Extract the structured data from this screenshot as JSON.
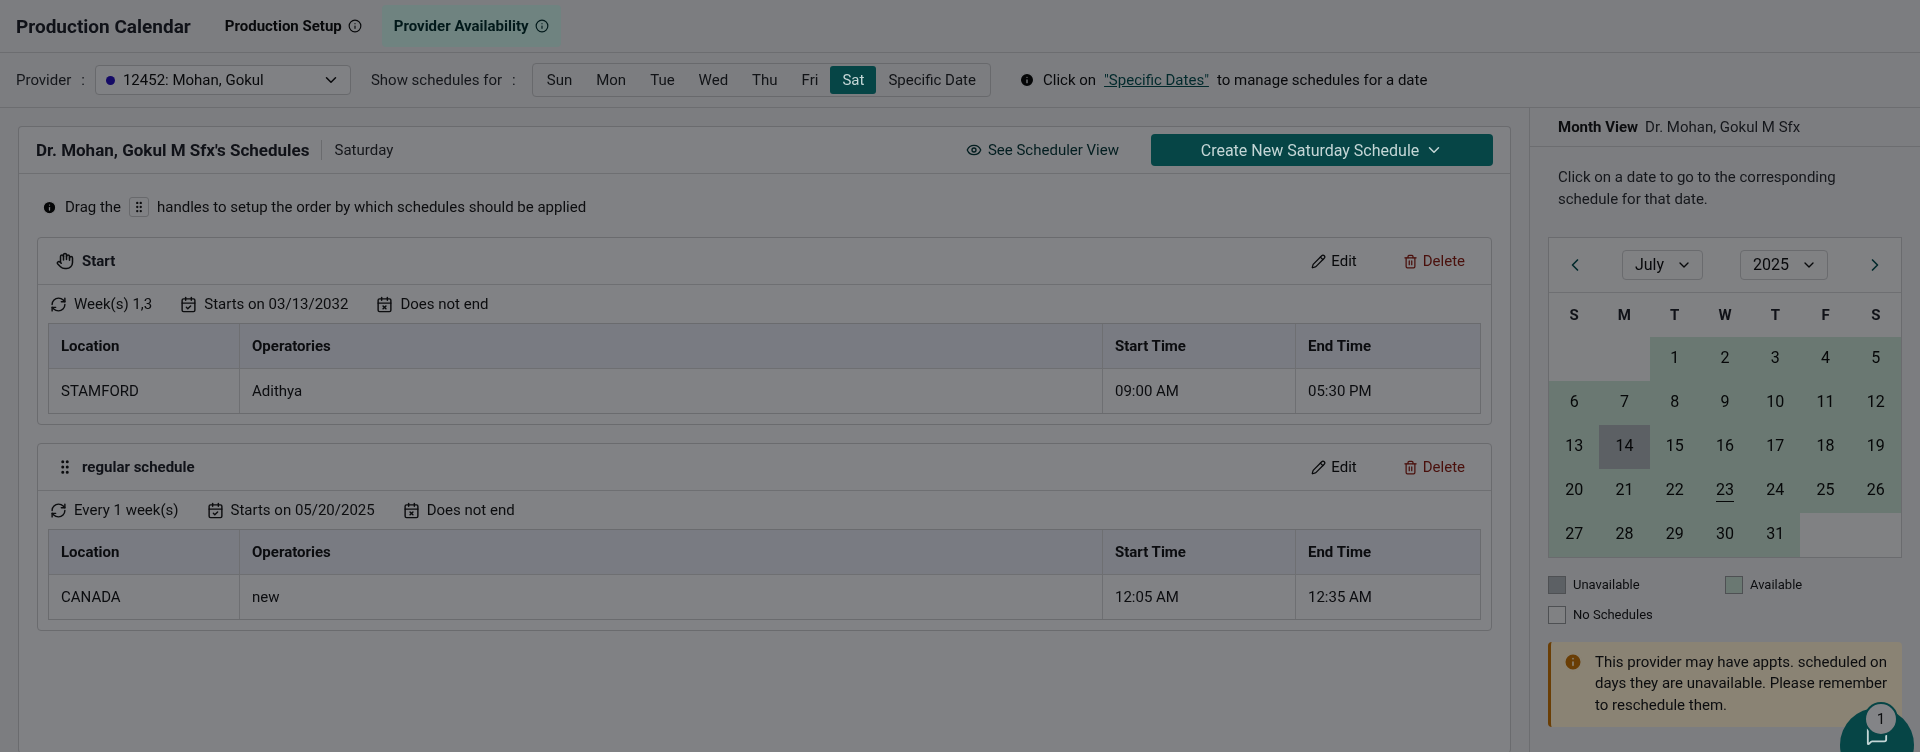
{
  "header": {
    "title": "Production Calendar",
    "tabs": [
      {
        "label": "Production Setup",
        "selected": false
      },
      {
        "label": "Provider Availability",
        "selected": true
      }
    ]
  },
  "toolbar": {
    "provider_label": "Provider",
    "provider_separator": ":",
    "provider_value": "12452: Mohan, Gokul",
    "show_label": "Show schedules for",
    "show_separator": ":",
    "days": [
      {
        "label": "Sun",
        "selected": false
      },
      {
        "label": "Mon",
        "selected": false
      },
      {
        "label": "Tue",
        "selected": false
      },
      {
        "label": "Wed",
        "selected": false
      },
      {
        "label": "Thu",
        "selected": false
      },
      {
        "label": "Fri",
        "selected": false
      },
      {
        "label": "Sat",
        "selected": true
      },
      {
        "label": "Specific Date",
        "selected": false
      }
    ],
    "hint_before": "Click on",
    "hint_link": "\"Specific Dates\"",
    "hint_after": "to manage schedules for a date"
  },
  "schedules_panel": {
    "title": "Dr. Mohan, Gokul M Sfx's Schedules",
    "subtitle": "Saturday",
    "scheduler_view": "See Scheduler View",
    "create_button": "Create New Saturday Schedule",
    "drag_hint_before": "Drag the",
    "drag_hint_after": "handles to setup the order by which schedules should be applied",
    "schedules": [
      {
        "name": "Start",
        "dragging": true,
        "recurrence": "Week(s) 1,3",
        "starts": "Starts on 03/13/2032",
        "ends": "Does not end",
        "edit": "Edit",
        "delete": "Delete",
        "columns": [
          "Location",
          "Operatories",
          "Start Time",
          "End Time"
        ],
        "rows": [
          [
            "STAMFORD",
            "Adithya",
            "09:00 AM",
            "05:30 PM"
          ]
        ]
      },
      {
        "name": "regular schedule",
        "dragging": false,
        "recurrence": "Every 1 week(s)",
        "starts": "Starts on 05/20/2025",
        "ends": "Does not end",
        "edit": "Edit",
        "delete": "Delete",
        "columns": [
          "Location",
          "Operatories",
          "Start Time",
          "End Time"
        ],
        "rows": [
          [
            "CANADA",
            "new",
            "12:05 AM",
            "12:35 AM"
          ]
        ]
      }
    ]
  },
  "month_view": {
    "title": "Month View",
    "provider": "Dr. Mohan, Gokul M Sfx",
    "hint": "Click on a date to go to the corresponding schedule for that date.",
    "month": "July",
    "year": "2025",
    "weekdays": [
      "S",
      "M",
      "T",
      "W",
      "T",
      "F",
      "S"
    ],
    "weeks": [
      [
        {
          "kind": "blank"
        },
        {
          "kind": "blank"
        },
        {
          "kind": "day",
          "day": "1",
          "available": true
        },
        {
          "kind": "day",
          "day": "2",
          "available": true
        },
        {
          "kind": "day",
          "day": "3",
          "available": true
        },
        {
          "kind": "day",
          "day": "4",
          "available": true
        },
        {
          "kind": "day",
          "day": "5",
          "available": true
        }
      ],
      [
        {
          "kind": "day",
          "day": "6",
          "available": true
        },
        {
          "kind": "day",
          "day": "7",
          "available": true
        },
        {
          "kind": "day",
          "day": "8",
          "available": true
        },
        {
          "kind": "day",
          "day": "9",
          "available": true
        },
        {
          "kind": "day",
          "day": "10",
          "available": true
        },
        {
          "kind": "day",
          "day": "11",
          "available": true
        },
        {
          "kind": "day",
          "day": "12",
          "available": true
        }
      ],
      [
        {
          "kind": "day",
          "day": "13",
          "available": true
        },
        {
          "kind": "day",
          "day": "14",
          "available": false
        },
        {
          "kind": "day",
          "day": "15",
          "available": true
        },
        {
          "kind": "day",
          "day": "16",
          "available": true
        },
        {
          "kind": "day",
          "day": "17",
          "available": true
        },
        {
          "kind": "day",
          "day": "18",
          "available": true
        },
        {
          "kind": "day",
          "day": "19",
          "available": true
        }
      ],
      [
        {
          "kind": "day",
          "day": "20",
          "available": true
        },
        {
          "kind": "day",
          "day": "21",
          "available": true
        },
        {
          "kind": "day",
          "day": "22",
          "available": true
        },
        {
          "kind": "day",
          "day": "23",
          "available": true,
          "today": true
        },
        {
          "kind": "day",
          "day": "24",
          "available": true
        },
        {
          "kind": "day",
          "day": "25",
          "available": true
        },
        {
          "kind": "day",
          "day": "26",
          "available": true
        }
      ],
      [
        {
          "kind": "day",
          "day": "27",
          "available": true
        },
        {
          "kind": "day",
          "day": "28",
          "available": true
        },
        {
          "kind": "day",
          "day": "29",
          "available": true
        },
        {
          "kind": "day",
          "day": "30",
          "available": true
        },
        {
          "kind": "day",
          "day": "31",
          "available": true
        },
        {
          "kind": "blank"
        },
        {
          "kind": "blank"
        }
      ]
    ],
    "legend": [
      {
        "label": "Unavailable",
        "kind": "unavailable"
      },
      {
        "label": "Available",
        "kind": "available"
      },
      {
        "label": "No Schedules",
        "kind": "empty"
      }
    ],
    "warning": "This provider may have appts. scheduled on days they are unavailable. Please remember to reschedule them."
  },
  "chat": {
    "badge": "1"
  }
}
